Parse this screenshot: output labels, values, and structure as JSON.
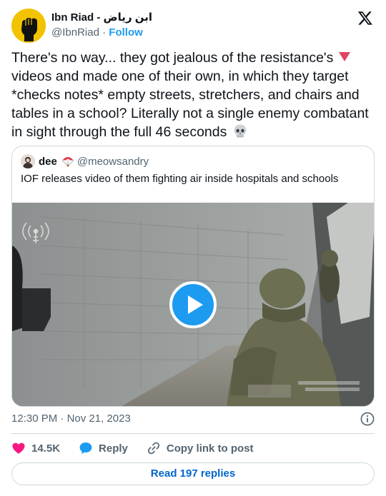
{
  "author": {
    "name": "Ibn Riad - ابن رياض",
    "handle": "@IbnRiad",
    "separator": "·",
    "follow_label": "Follow"
  },
  "tweet": {
    "text_part1": "There's no way... they got jealous of the resistance's ",
    "text_part2": " videos and made one of their own, in which they target *checks notes* empty streets, stretchers, and chairs and tables in a school? Literally not a single enemy combatant in sight through the full 46 seconds "
  },
  "quote": {
    "name": "dee",
    "handle": "@meowsandry",
    "text": "IOF releases video of them fighting air inside hospitals and schools"
  },
  "meta": {
    "time": "12:30 PM",
    "separator": "·",
    "date": "Nov 21, 2023"
  },
  "actions": {
    "likes": "14.5K",
    "reply_label": "Reply",
    "copy_label": "Copy link to post"
  },
  "read_replies_label": "Read 197 replies",
  "colors": {
    "accent": "#1d9bf0",
    "like": "#f91880",
    "secondary_text": "#536471",
    "border": "#cfd9de"
  },
  "icons": [
    "raised-fist-avatar",
    "x-logo-icon",
    "red-triangle-icon",
    "skull-icon",
    "parachute-icon",
    "play-icon",
    "info-icon",
    "heart-icon",
    "reply-bubble-icon",
    "link-icon"
  ]
}
